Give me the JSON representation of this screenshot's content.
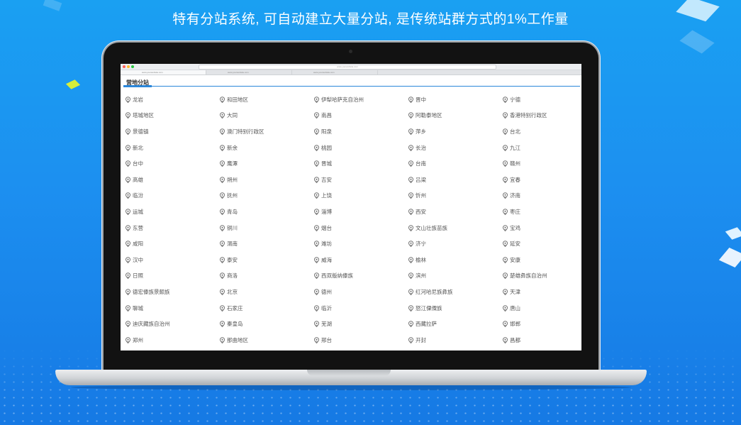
{
  "headline": "特有分站系统, 可自动建立大量分站, 是传统站群方式的1%工作量",
  "browser": {
    "url_text": "www.yourwebsite.com",
    "tabs": [
      "www.yourwebsite.com",
      "www.yourwebsite.com",
      "www.yourwebsite.com"
    ]
  },
  "page": {
    "title": "营地分站",
    "cities": [
      "龙岩",
      "和田地区",
      "伊犁哈萨克自治州",
      "晋中",
      "宁德",
      "塔城地区",
      "大同",
      "南昌",
      "阿勒泰地区",
      "香港特别行政区",
      "景德镇",
      "澳门特别行政区",
      "阳泉",
      "萍乡",
      "台北",
      "新北",
      "新余",
      "桃园",
      "长治",
      "九江",
      "台中",
      "鹰潭",
      "晋城",
      "台南",
      "赣州",
      "高雄",
      "朔州",
      "吉安",
      "吕梁",
      "宜春",
      "临汾",
      "抚州",
      "上饶",
      "忻州",
      "济南",
      "运城",
      "青岛",
      "淄博",
      "西安",
      "枣庄",
      "东营",
      "铜川",
      "烟台",
      "文山壮族苗族",
      "宝鸡",
      "咸阳",
      "渭南",
      "潍坊",
      "济宁",
      "延安",
      "汉中",
      "泰安",
      "威海",
      "榆林",
      "安康",
      "日照",
      "商洛",
      "西双版纳傣族",
      "滨州",
      "楚雄彝族自治州",
      "德宏傣族景颇族",
      "北京",
      "德州",
      "红河哈尼族彝族",
      "天津",
      "聊城",
      "石家庄",
      "临沂",
      "怒江傈僳族",
      "唐山",
      "迪庆藏族自治州",
      "秦皇岛",
      "芜湖",
      "西藏拉萨",
      "邯郸",
      "郑州",
      "那曲地区",
      "邢台",
      "开封",
      "昌都"
    ]
  },
  "colors": {
    "accent": "#2b87da",
    "background": "#1c8ff0"
  }
}
